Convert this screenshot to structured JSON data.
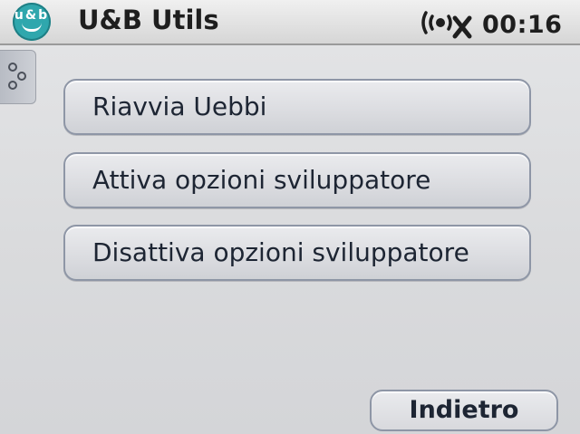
{
  "titlebar": {
    "logo_text": "u&b",
    "title": "U&B Utils",
    "signal_icon": "wireless-disconnected-icon",
    "clock": "00:16"
  },
  "sidebar": {
    "tab_icon": "dots-menu-icon"
  },
  "menu": {
    "items": [
      {
        "label": "Riavvia Uebbi"
      },
      {
        "label": "Attiva opzioni sviluppatore"
      },
      {
        "label": "Disattiva opzioni sviluppatore"
      }
    ]
  },
  "footer": {
    "back_label": "Indietro"
  },
  "colors": {
    "logo": "#2fa7ad",
    "button_border": "#8e96a6",
    "text": "#1d2533"
  }
}
